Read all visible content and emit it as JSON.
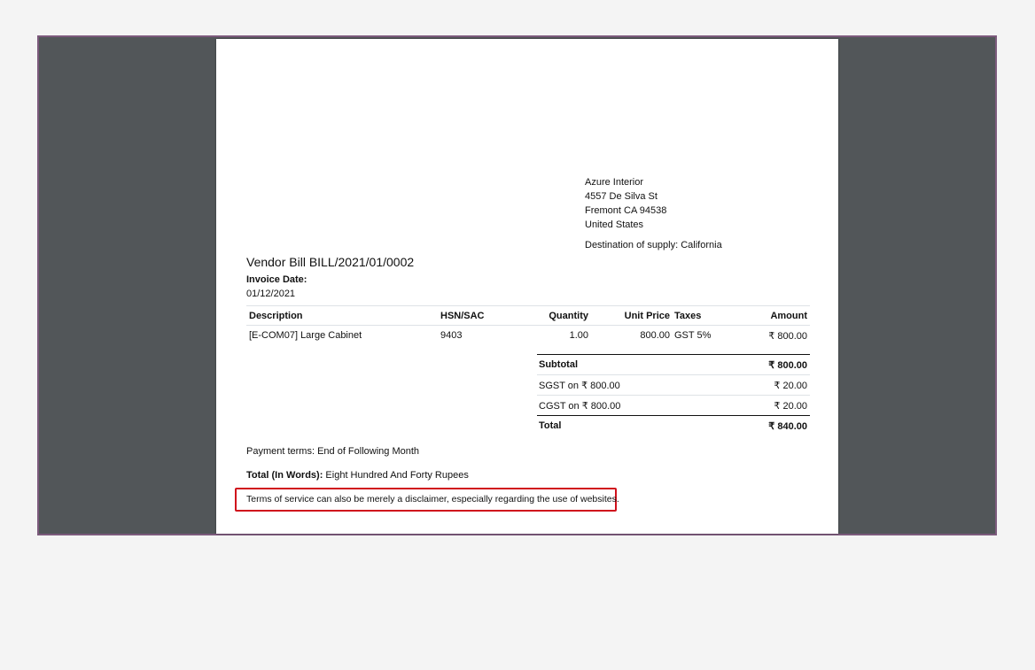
{
  "partner": {
    "name": "Azure Interior",
    "street": "4557 De Silva St",
    "city_line": "Fremont CA 94538",
    "country": "United States"
  },
  "destination": "Destination of supply: California",
  "title": "Vendor Bill BILL/2021/01/0002",
  "invoice_date_label": "Invoice Date:",
  "invoice_date": "01/12/2021",
  "lines": {
    "headers": {
      "description": "Description",
      "hsn": "HSN/SAC",
      "quantity": "Quantity",
      "unit_price": "Unit Price",
      "taxes": "Taxes",
      "amount": "Amount"
    },
    "rows": [
      {
        "description": "[E-COM07] Large Cabinet",
        "hsn": "9403",
        "quantity": "1.00",
        "unit_price": "800.00",
        "taxes": "GST 5%",
        "amount": "₹ 800.00"
      }
    ]
  },
  "totals": {
    "subtotal_label": "Subtotal",
    "subtotal": "₹ 800.00",
    "sgst_label": "SGST on ₹ 800.00",
    "sgst": "₹ 20.00",
    "cgst_label": "CGST on ₹ 800.00",
    "cgst": "₹ 20.00",
    "total_label": "Total",
    "total": "₹ 840.00"
  },
  "payment_terms": "Payment terms: End of Following Month",
  "total_words_label": "Total (In Words):",
  "total_words": "Eight Hundred And Forty Rupees",
  "terms_of_service": "Terms of service can also be merely a disclaimer, especially regarding the use of websites.",
  "colors": {
    "frame_border": "#7c5a7c",
    "viewer_background": "#525659",
    "highlight_border": "#d0101c"
  }
}
